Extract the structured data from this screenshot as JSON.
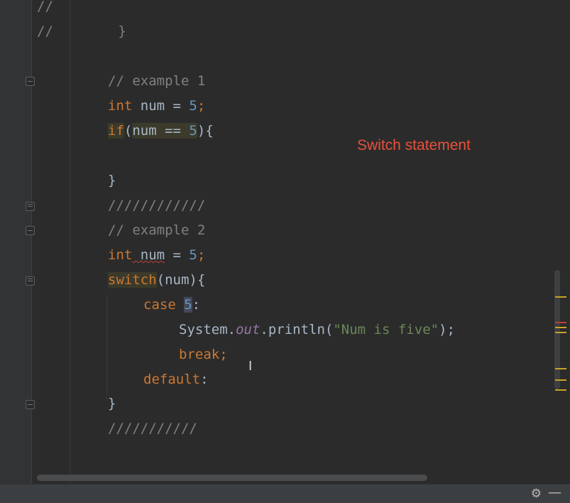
{
  "code_lines": [
    {
      "id": "l0",
      "parts": [
        {
          "t": "//",
          "c": "cmt"
        }
      ]
    },
    {
      "id": "l1",
      "parts": [
        {
          "t": "//",
          "c": "cmt"
        },
        {
          "t": "        }",
          "c": "cmt"
        }
      ]
    },
    {
      "id": "l2",
      "parts": []
    },
    {
      "id": "l3",
      "parts": [
        {
          "t": "// example 1",
          "c": "cmt"
        }
      ]
    },
    {
      "id": "l4",
      "parts": [
        {
          "t": "int",
          "c": "kw"
        },
        {
          "t": " num = "
        },
        {
          "t": "5",
          "c": "num"
        },
        {
          "t": ";",
          "c": "kw"
        }
      ]
    },
    {
      "id": "l5",
      "parts": [
        {
          "t": "if",
          "c": "kw"
        },
        {
          "t": "("
        },
        {
          "t": "num == "
        },
        {
          "t": "5",
          "c": "num"
        },
        {
          "t": "){"
        }
      ]
    },
    {
      "id": "l6",
      "parts": []
    },
    {
      "id": "l7",
      "parts": [
        {
          "t": "}"
        }
      ]
    },
    {
      "id": "l8",
      "parts": [
        {
          "t": "////////////",
          "c": "cmt"
        }
      ]
    },
    {
      "id": "l9",
      "parts": [
        {
          "t": "// example 2",
          "c": "cmt"
        }
      ]
    },
    {
      "id": "l10",
      "parts": [
        {
          "t": "int",
          "c": "kw"
        },
        {
          "t": " num",
          "w": 1
        },
        {
          "t": " = "
        },
        {
          "t": "5",
          "c": "num"
        },
        {
          "t": ";",
          "c": "kw"
        }
      ]
    },
    {
      "id": "l11",
      "parts": [
        {
          "t": "switch",
          "c": "kw"
        },
        {
          "t": "(num){"
        }
      ]
    },
    {
      "id": "l12",
      "parts": [
        {
          "t": "case ",
          "c": "kw"
        },
        {
          "t": "5",
          "c": "num"
        },
        {
          "t": ":"
        }
      ]
    },
    {
      "id": "l13",
      "parts": [
        {
          "t": "System."
        },
        {
          "t": "out",
          "c": "fld"
        },
        {
          "t": ".println("
        },
        {
          "t": "\"Num is five\"",
          "c": "str"
        },
        {
          "t": ");"
        },
        {
          "t": "",
          "c": "kw"
        }
      ]
    },
    {
      "id": "l14",
      "parts": [
        {
          "t": "break;",
          "c": "kw"
        }
      ]
    },
    {
      "id": "l15",
      "parts": [
        {
          "t": "default",
          "c": "kw"
        },
        {
          "t": ":"
        }
      ]
    },
    {
      "id": "l16",
      "parts": [
        {
          "t": "}"
        }
      ]
    },
    {
      "id": "l17",
      "parts": [
        {
          "t": "///////////",
          "c": "cmt"
        }
      ]
    }
  ],
  "annotation": {
    "text": "Switch statement",
    "color": "#e9513b"
  },
  "icons": {
    "gear": "gear-icon",
    "minimize": "minimize-icon",
    "cursor": "i-beam-cursor"
  },
  "cursor_glyph": "I",
  "gear_glyph": "⚙",
  "minimize_glyph": "—"
}
